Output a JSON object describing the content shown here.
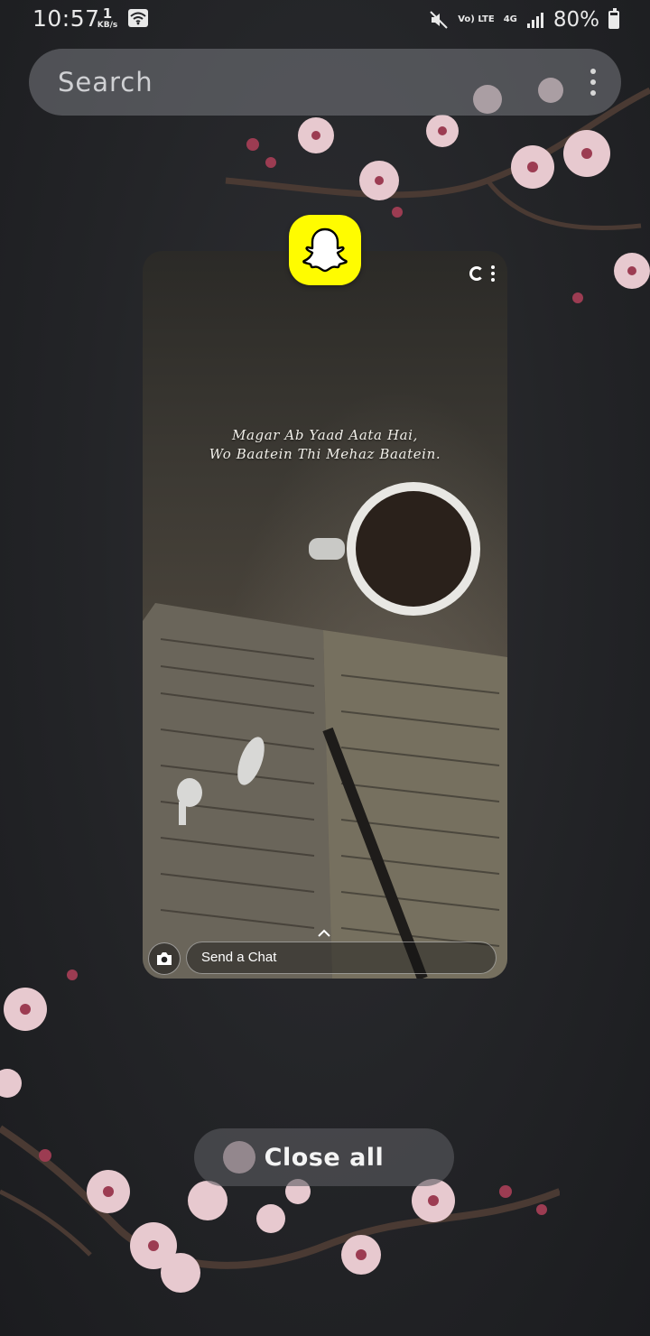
{
  "status_bar": {
    "time": "10:57",
    "net_speed_value": "1",
    "net_speed_unit": "KB/s",
    "volte_label": "Vo) LTE",
    "network_type": "4G",
    "battery_percent": "80%"
  },
  "search": {
    "placeholder": "Search"
  },
  "recent_app": {
    "icon": "snapchat-ghost-icon",
    "icon_color": "#FFFC00",
    "quote_line_1": "Magar Ab Yaad Aata Hai,",
    "quote_line_2": "Wo Baatein Thi Mehaz Baatein.",
    "chat_placeholder": "Send a Chat"
  },
  "footer": {
    "close_all_label": "Close all"
  }
}
